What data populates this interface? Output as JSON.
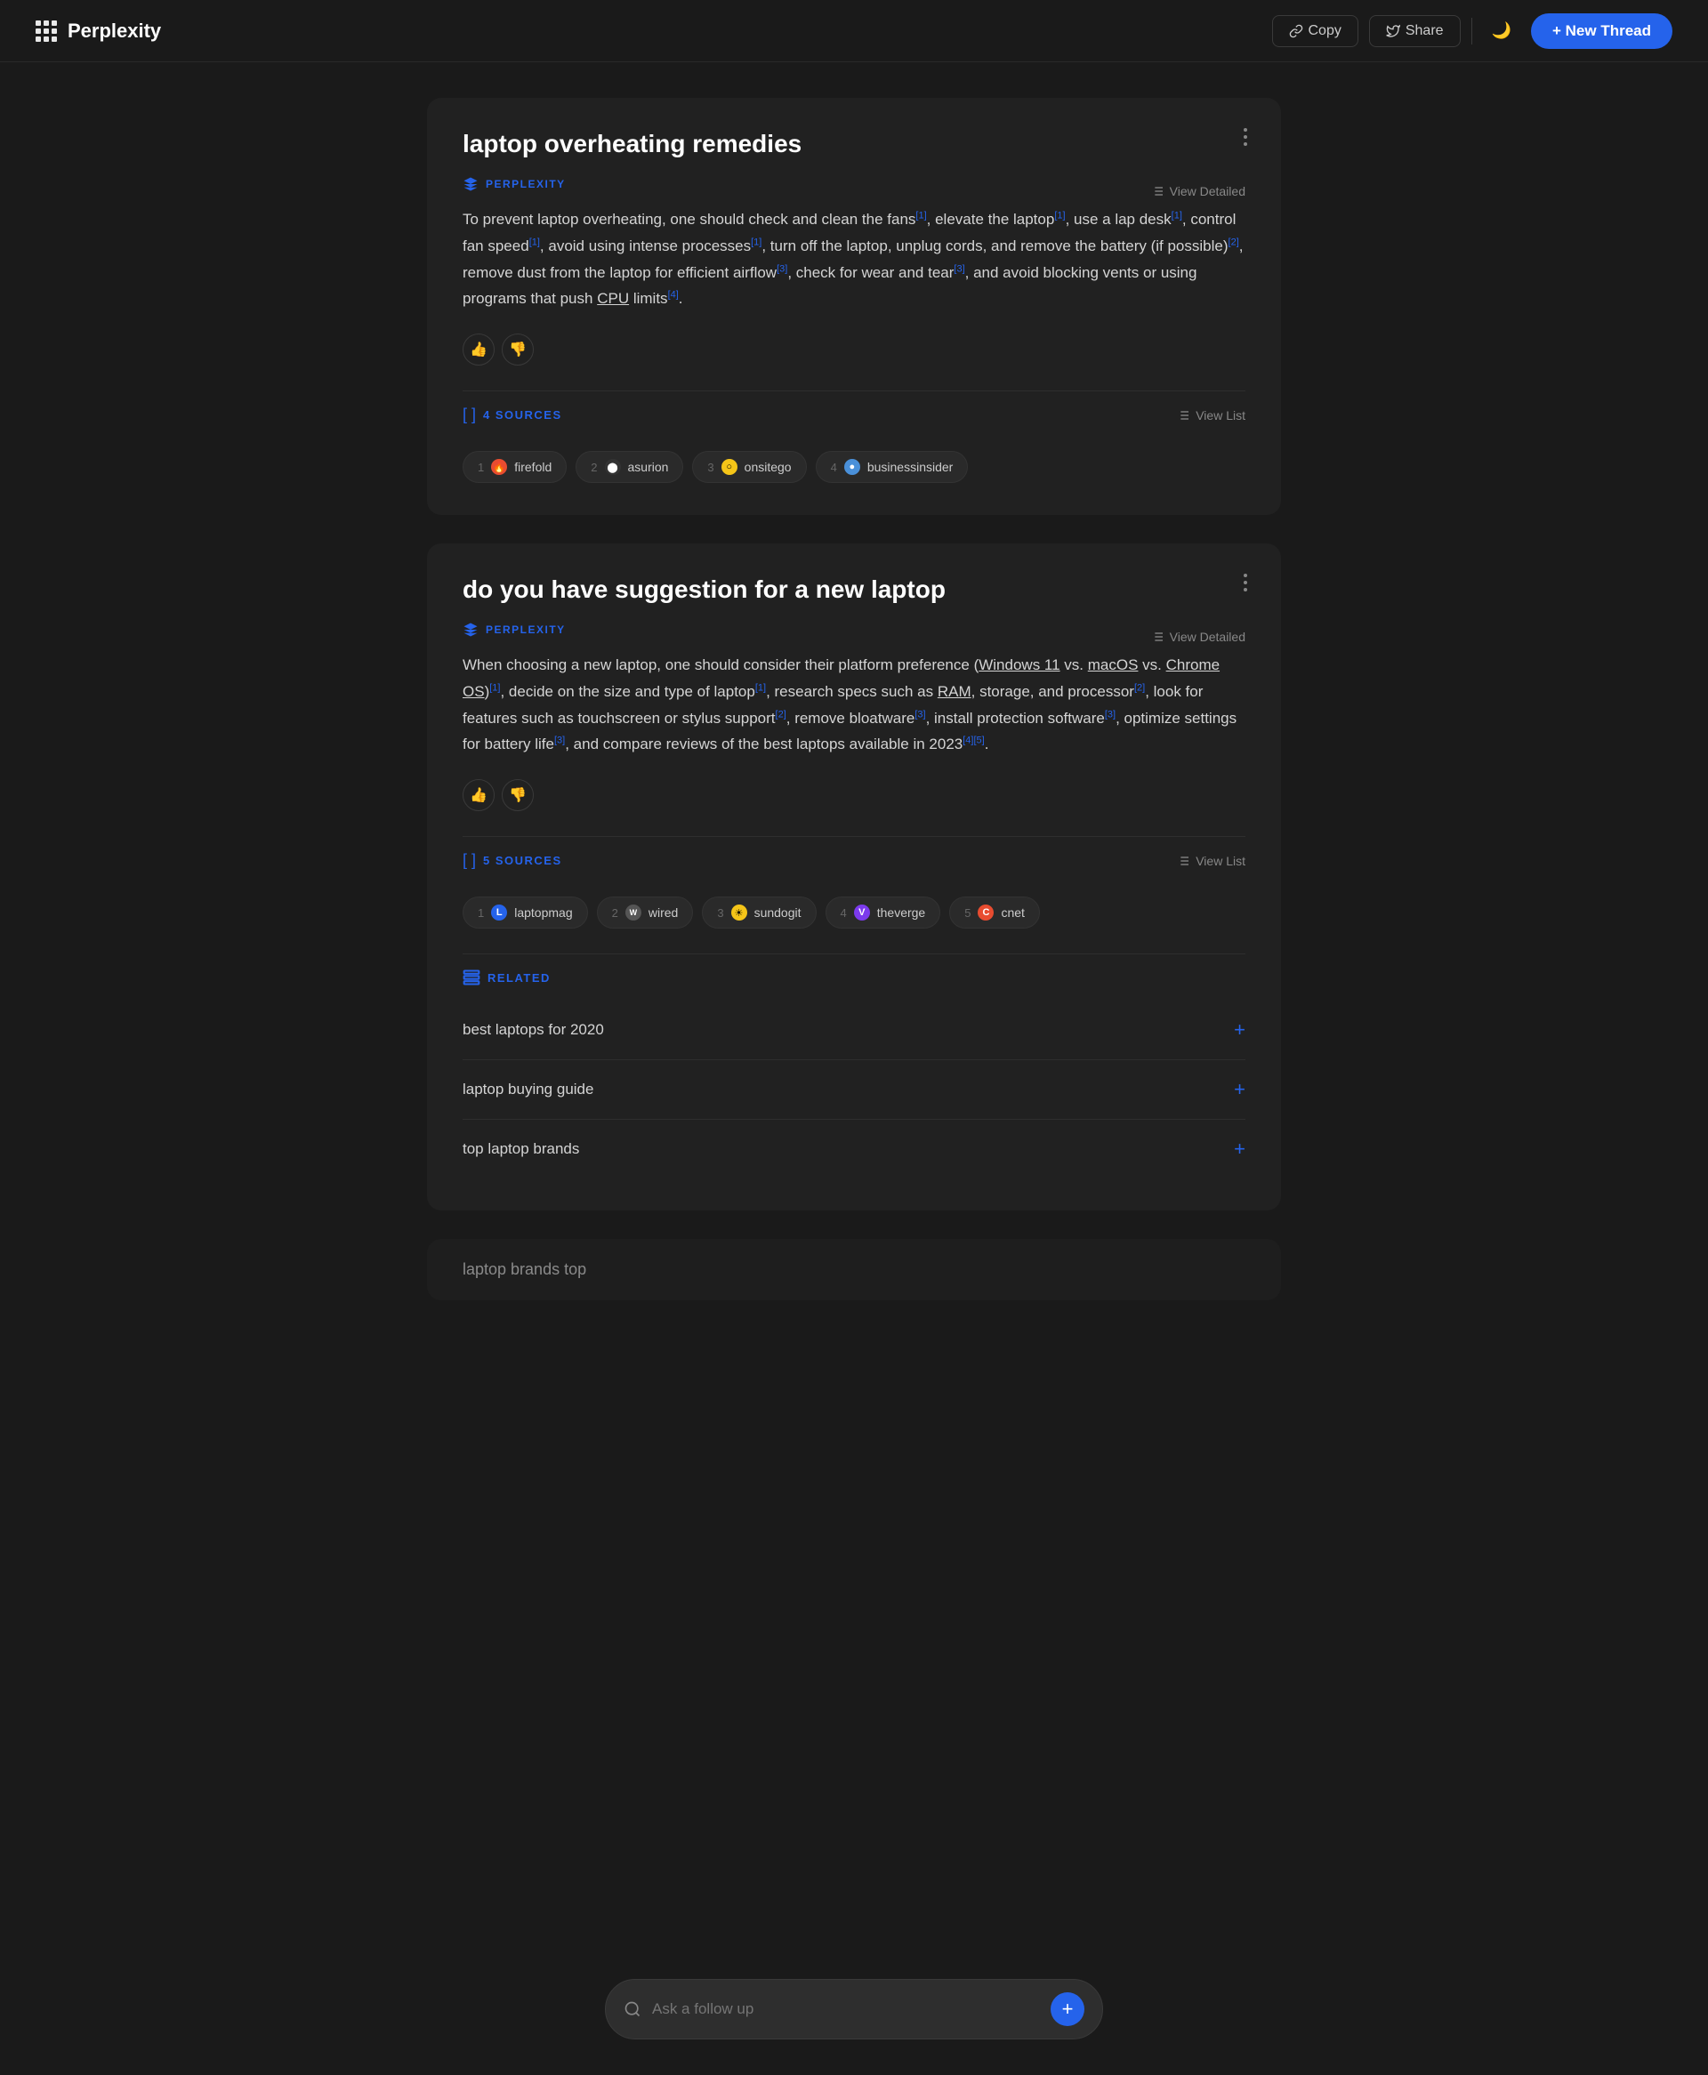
{
  "header": {
    "logo": "Perplexity",
    "copy_btn": "Copy",
    "share_btn": "Share",
    "new_thread_btn": "+ New Thread",
    "dark_mode_icon": "🌙"
  },
  "thread1": {
    "title": "laptop overheating remedies",
    "source_label": "PERPLEXITY",
    "view_detailed": "View Detailed",
    "answer": "To prevent laptop overheating, one should check and clean the fans",
    "answer_refs1": "[1]",
    "answer_part2": ", elevate the laptop",
    "answer_refs2": "[1]",
    "answer_part3": ", use a lap desk",
    "answer_refs3": "[1]",
    "answer_part4": ", control fan speed",
    "answer_refs4": "[1]",
    "answer_part5": ", avoid using intense processes",
    "answer_refs5": "[1]",
    "answer_part6": ", turn off the laptop, unplug cords, and remove the battery (if possible)",
    "answer_refs6": "[2]",
    "answer_part7": ", remove dust from the laptop for efficient airflow",
    "answer_refs7": "[3]",
    "answer_part8": ", check for wear and tear",
    "answer_refs8": "[3]",
    "answer_part9": ", and avoid blocking vents or using programs that push ",
    "answer_cpu": "CPU",
    "answer_part10": " limits",
    "answer_refs9": "[4]",
    "answer_end": ".",
    "sources_count": "4 SOURCES",
    "view_list": "View List",
    "sources": [
      {
        "num": "1",
        "name": "firefold",
        "icon_color": "#e84c30",
        "icon_char": "🔥"
      },
      {
        "num": "2",
        "name": "asurion",
        "icon_color": "#222",
        "icon_char": "⬤"
      },
      {
        "num": "3",
        "name": "onsitego",
        "icon_color": "#f5c518",
        "icon_char": "○"
      },
      {
        "num": "4",
        "name": "businessinsider",
        "icon_color": "#4a90d9",
        "icon_char": "●"
      }
    ]
  },
  "thread2": {
    "title": "do you have suggestion for a new laptop",
    "source_label": "PERPLEXITY",
    "view_detailed": "View Detailed",
    "answer_part1": "When choosing a new laptop, one should consider their platform preference (",
    "link1": "Windows 11",
    "answer_vs1": " vs. ",
    "link2": "macOS",
    "answer_vs2": " vs. ",
    "link3": "Chrome OS",
    "answer_refs1": "[1]",
    "answer_part2": ", decide on the size and type of laptop",
    "answer_refs2": "[1]",
    "answer_part3": ", research specs such as ",
    "link_ram": "RAM",
    "answer_part4": ", storage, and processor",
    "answer_refs3": "[2]",
    "answer_part5": ", look for features such as touchscreen or stylus support",
    "answer_refs4": "[2]",
    "answer_part6": ", remove bloatware",
    "answer_refs5": "[3]",
    "answer_part7": ", install protection software",
    "answer_refs6": "[3]",
    "answer_part8": ", optimize settings for battery life",
    "answer_refs7": "[3]",
    "answer_part9": ", and compare reviews of the best laptops available in 2023",
    "answer_refs8": "[4][5]",
    "answer_end": ".",
    "sources_count": "5 SOURCES",
    "view_list": "View List",
    "sources": [
      {
        "num": "1",
        "name": "laptopmag",
        "icon_color": "#2563eb",
        "icon_char": "L"
      },
      {
        "num": "2",
        "name": "wired",
        "icon_color": "#ccc",
        "icon_char": "W"
      },
      {
        "num": "3",
        "name": "sundogit",
        "icon_color": "#f5c518",
        "icon_char": "☀"
      },
      {
        "num": "4",
        "name": "theverge",
        "icon_color": "#7c3aed",
        "icon_char": "V"
      },
      {
        "num": "5",
        "name": "cnet",
        "icon_color": "#e84c30",
        "icon_char": "C"
      }
    ],
    "related_label": "RELATED",
    "related_items": [
      {
        "text": "best laptops for 2020"
      },
      {
        "text": "laptop buying guide"
      },
      {
        "text": "top laptop brands"
      }
    ]
  },
  "search": {
    "placeholder": "Ask a follow up",
    "plus_icon": "+"
  },
  "bottom_thread": {
    "search_text": "laptop brands top"
  }
}
